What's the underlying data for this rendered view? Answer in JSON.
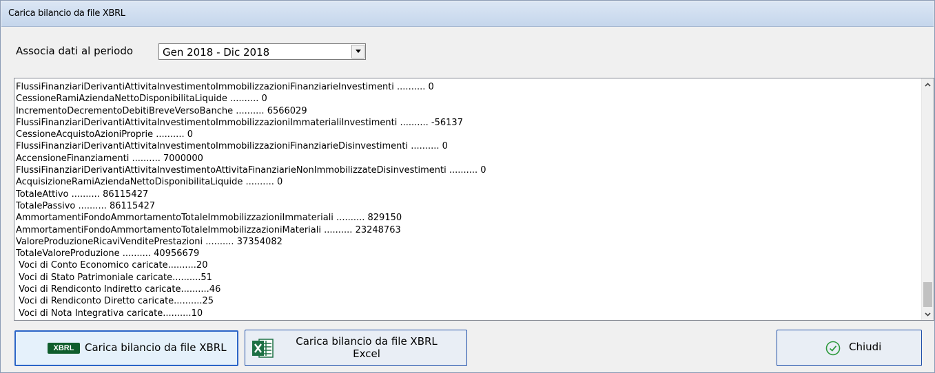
{
  "window": {
    "title": "Carica bilancio da file XBRL"
  },
  "period": {
    "label": "Associa dati al periodo",
    "selected": "Gen 2018 - Dic 2018"
  },
  "log": {
    "lines": [
      "FlussiFinanziariDerivantiAttivitaInvestimentoImmobilizzazioniFinanziarieInvestimenti .......... 0",
      "CessioneRamiAziendaNettoDisponibilitaLiquide .......... 0",
      "IncrementoDecrementoDebitiBreveVersoBanche .......... 6566029",
      "FlussiFinanziariDerivantiAttivitaInvestimentoImmobilizzazioniImmaterialiInvestimenti .......... -56137",
      "CessioneAcquistoAzioniProprie .......... 0",
      "FlussiFinanziariDerivantiAttivitaInvestimentoImmobilizzazioniFinanziarieDisinvestimenti .......... 0",
      "AccensioneFinanziamenti .......... 7000000",
      "FlussiFinanziariDerivantiAttivitaInvestimentoAttivitaFinanziarieNonImmobilizzateDisinvestimenti .......... 0",
      "AcquisizioneRamiAziendaNettoDisponibilitaLiquide .......... 0",
      "TotaleAttivo .......... 86115427",
      "TotalePassivo .......... 86115427",
      "AmmortamentiFondoAmmortamentoTotaleImmobilizzazioniImmateriali .......... 829150",
      "AmmortamentiFondoAmmortamentoTotaleImmobilizzazioniMateriali .......... 23248763",
      "ValoreProduzioneRicaviVenditePrestazioni .......... 37354082",
      "TotaleValoreProduzione .......... 40956679",
      " Voci di Conto Economico caricate..........20",
      " Voci di Stato Patrimoniale caricate..........51",
      " Voci di Rendiconto Indiretto caricate..........46",
      " Voci di Rendiconto Diretto caricate..........25",
      " Voci di Nota Integrativa caricate..........10"
    ]
  },
  "buttons": {
    "xbrl": {
      "badge": "XBRL",
      "label": "Carica bilancio da file XBRL"
    },
    "excel": {
      "label_line1": "Carica bilancio da file XBRL",
      "label_line2": "Excel"
    },
    "close": {
      "label": "Chiudi"
    }
  },
  "colors": {
    "title_bar": "#c9d9ee",
    "button_border": "#1f4fa8",
    "xbrl_badge": "#0f5d2c",
    "excel_green": "#1d7044",
    "check_green": "#2f9a3e"
  }
}
